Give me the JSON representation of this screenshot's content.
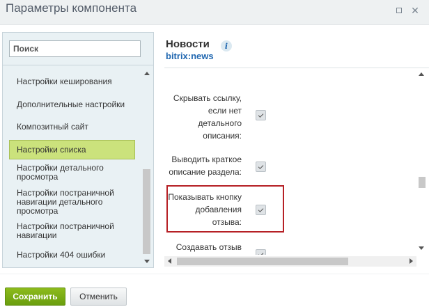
{
  "window": {
    "title": "Параметры компонента"
  },
  "sidebar": {
    "search_placeholder": "Поиск",
    "items": [
      {
        "label": "Настройки кеширования"
      },
      {
        "label": "Дополнительные настройки"
      },
      {
        "label": "Композитный сайт"
      },
      {
        "label": "Настройки списка",
        "active": true
      },
      {
        "label": "Настройки детального просмотра"
      },
      {
        "label": "Настройки постраничной навигации детального просмотра"
      },
      {
        "label": "Настройки постраничной навигации"
      },
      {
        "label": "Настройки 404 ошибки"
      }
    ]
  },
  "component": {
    "name": "Новости",
    "id": "bitrix:news"
  },
  "params": [
    {
      "label": "Скрывать ссылку, если нет детального описания:",
      "checked": true
    },
    {
      "label": "Выводить краткое описание раздела:",
      "checked": true
    },
    {
      "label": "Показывать кнопку добавления отзыва:",
      "checked": true,
      "highlighted": true
    },
    {
      "label": "Создавать отзыв",
      "checked": true
    }
  ],
  "footer": {
    "save_label": "Сохранить",
    "cancel_label": "Отменить"
  },
  "colors": {
    "accent_green": "#8dbb1c",
    "active_item": "#cbe27c",
    "highlight": "#b62025",
    "link": "#2067b0"
  }
}
